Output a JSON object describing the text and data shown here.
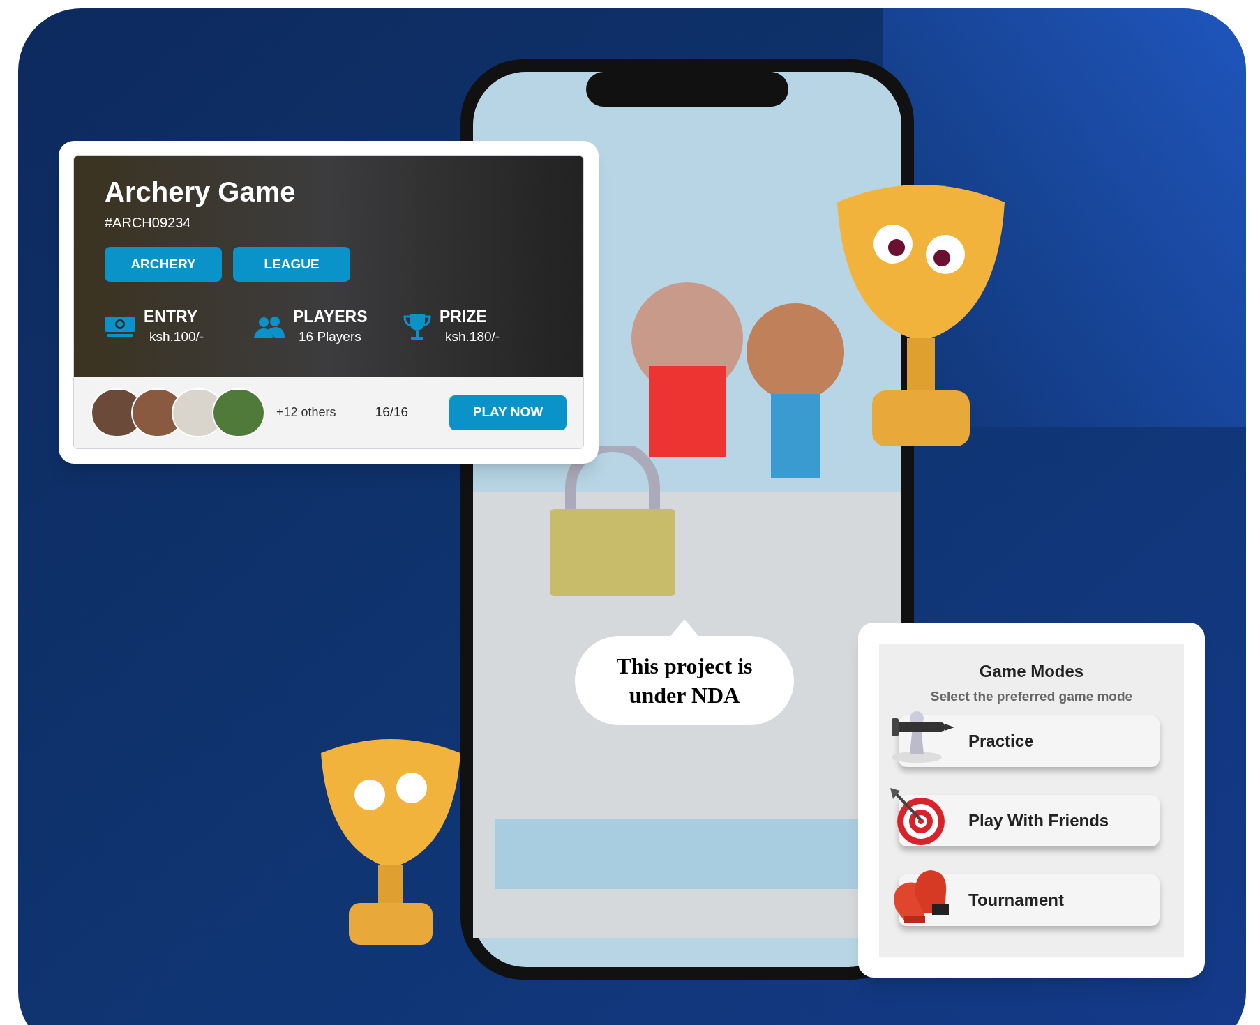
{
  "game_card": {
    "title": "Archery Game",
    "code": "#ARCH09234",
    "tags": [
      "ARCHERY",
      "LEAGUE"
    ],
    "stats": [
      {
        "kind": "money",
        "label": "ENTRY",
        "value": "ksh.100/-"
      },
      {
        "kind": "people",
        "label": "PLAYERS",
        "value": "16 Players"
      },
      {
        "kind": "trophy",
        "label": "PRIZE",
        "value": "ksh.180/-"
      }
    ],
    "others": "+12 others",
    "slots": "16/16",
    "button": "PLAY NOW"
  },
  "nda_bubble": "This project is under NDA",
  "game_modes": {
    "title": "Game Modes",
    "subtitle": "Select the preferred game mode",
    "modes": [
      {
        "kind": "chess",
        "label": "Practice"
      },
      {
        "kind": "target",
        "label": "Play With Friends"
      },
      {
        "kind": "gloves",
        "label": "Tournament"
      }
    ]
  }
}
